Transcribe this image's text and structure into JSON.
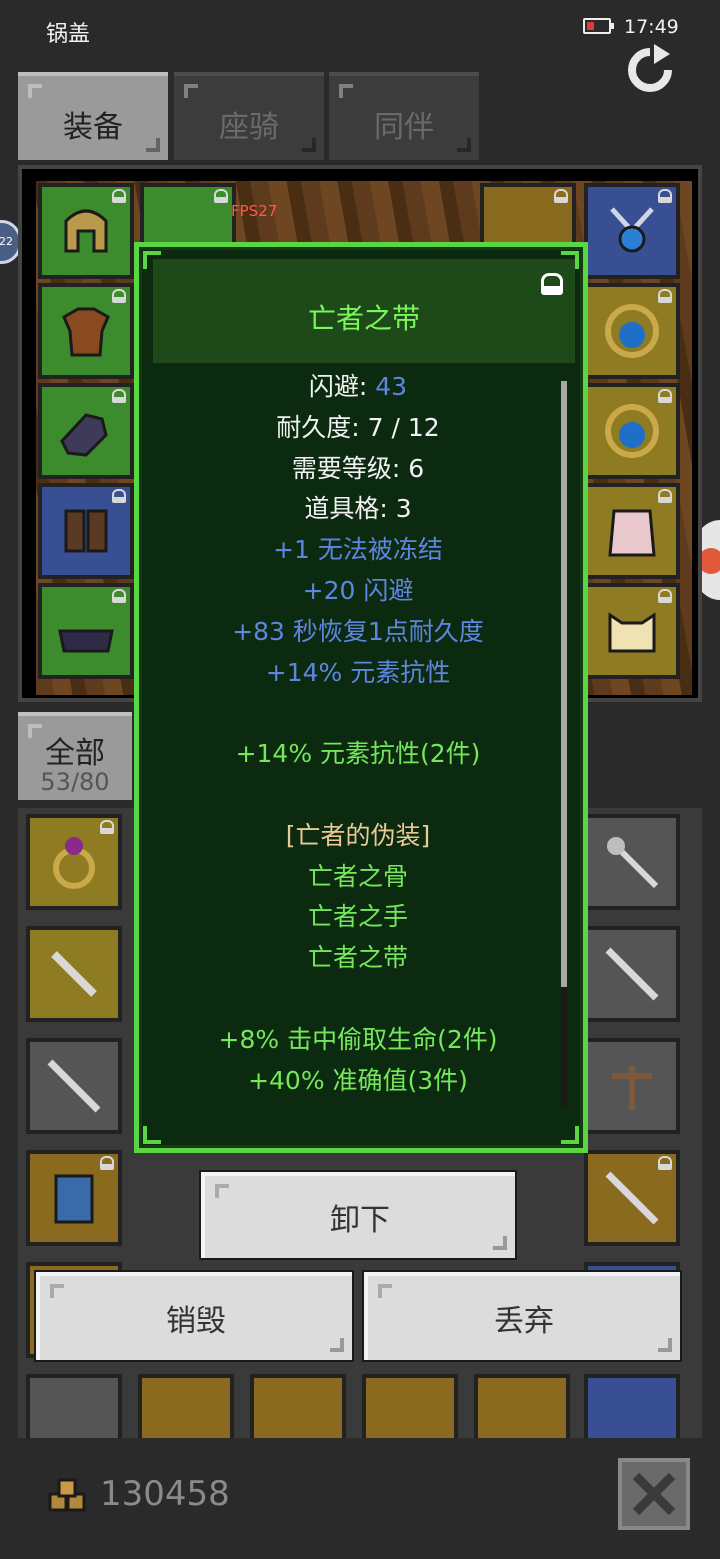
{
  "status_bar": {
    "app_name": "锅盖",
    "time": "17:49"
  },
  "tabs": [
    {
      "label": "装备",
      "active": true
    },
    {
      "label": "座骑",
      "active": false
    },
    {
      "label": "同伴",
      "active": false
    }
  ],
  "fps": "FPS27",
  "category": {
    "label": "全部",
    "count": "53/80"
  },
  "tooltip": {
    "name": "亡者之带",
    "stats": [
      {
        "label": "闪避: ",
        "value": "43"
      },
      {
        "label": "耐久度: 7 / 12"
      },
      {
        "label": "需要等级: 6"
      },
      {
        "label": "道具格: 3"
      }
    ],
    "bonuses": [
      "+1 无法被冻结",
      "+20 闪避",
      "+83 秒恢复1点耐久度",
      "+14% 元素抗性"
    ],
    "set_bonus_1": "+14% 元素抗性(2件)",
    "set_name": "[亡者的伪装]",
    "set_items": [
      "亡者之骨",
      "亡者之手",
      "亡者之带"
    ],
    "set_bonus_2": [
      "+8% 击中偷取生命(2件)",
      "+40% 准确值(3件)"
    ]
  },
  "actions": {
    "unequip": "卸下",
    "destroy": "销毁",
    "drop": "丢弃"
  },
  "footer": {
    "gold": "130458"
  },
  "badges": {
    "left": "22"
  },
  "colors": {
    "tooltip_border": "#5ad645",
    "item_name": "#7bf65b",
    "bonus_blue": "#5d86e0",
    "set_green": "#74e85a"
  }
}
